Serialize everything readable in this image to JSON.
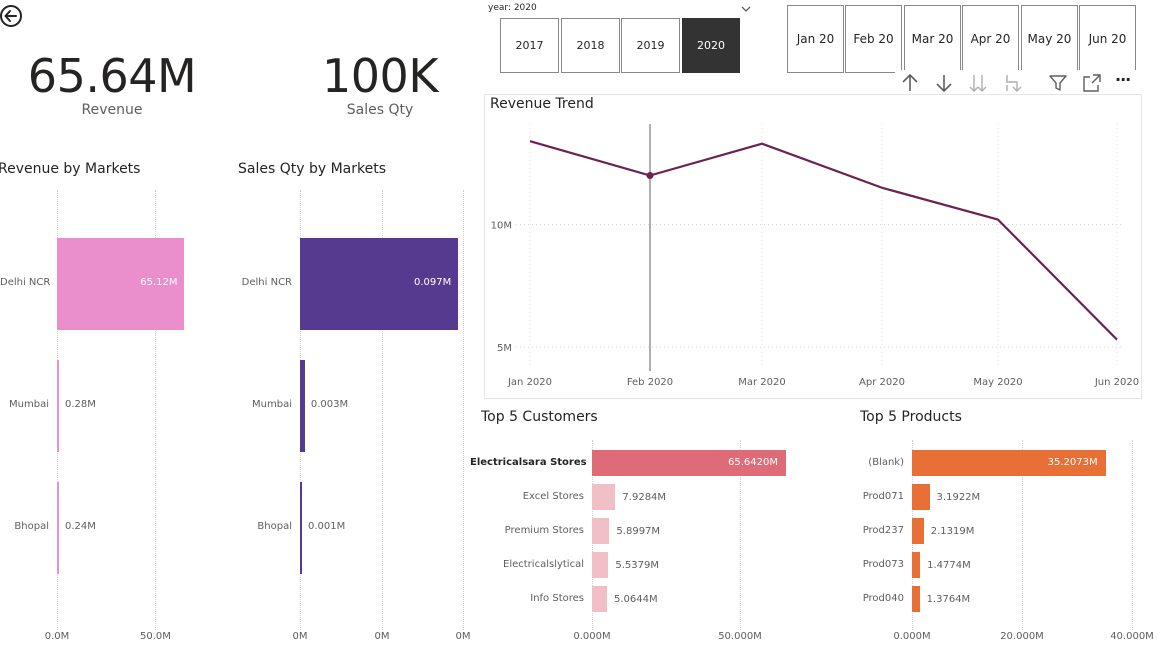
{
  "kpis": {
    "revenue": {
      "value": "65.64M",
      "label": "Revenue"
    },
    "sales_qty": {
      "value": "100K",
      "label": "Sales Qty"
    }
  },
  "year_slicer": {
    "header": "year: 2020",
    "options": [
      "2017",
      "2018",
      "2019",
      "2020"
    ],
    "selected": "2020"
  },
  "month_slicer": {
    "options": [
      "Jan 20",
      "Feb 20",
      "Mar 20",
      "Apr 20",
      "May 20",
      "Jun 20"
    ]
  },
  "toolbar": {
    "icons": [
      "sort-ascending-icon",
      "sort-descending-icon",
      "expand-all-down-icon",
      "expand-down-icon",
      "filter-icon",
      "focus-mode-icon",
      "more-options-icon"
    ],
    "more_label": "···"
  },
  "colors": {
    "revenue_bar": "#ea8fcc",
    "qty_bar": "#563a8f",
    "trend_line": "#6b2152",
    "customers_bar_top": "#e06b78",
    "customers_bar": "#f1c0c6",
    "products_bar": "#e87036"
  },
  "revenue_by_markets": {
    "title": "Revenue by Markets",
    "x_ticks": [
      "0.0M",
      "50.0M"
    ],
    "chart_data": {
      "type": "bar",
      "categories": [
        "Delhi NCR",
        "Mumbai",
        "Bhopal"
      ],
      "values": [
        65.12,
        0.28,
        0.24
      ],
      "value_labels": [
        "65.12M",
        "0.28M",
        "0.24M"
      ],
      "xlim": [
        0,
        65
      ]
    }
  },
  "sales_qty_by_markets": {
    "title": "Sales Qty by Markets",
    "x_ticks": [
      "0M",
      "0M",
      "0M"
    ],
    "chart_data": {
      "type": "bar",
      "categories": [
        "Delhi NCR",
        "Mumbai",
        "Bhopal"
      ],
      "values": [
        0.097,
        0.003,
        0.001
      ],
      "value_labels": [
        "0.097M",
        "0.003M",
        "0.001M"
      ],
      "xlim": [
        0,
        0.097
      ]
    }
  },
  "revenue_trend": {
    "title": "Revenue Trend",
    "y_ticks": [
      "10M",
      "5M"
    ],
    "chart_data": {
      "type": "line",
      "x": [
        "Jan 2020",
        "Feb 2020",
        "Mar 2020",
        "Apr 2020",
        "May 2020",
        "Jun 2020"
      ],
      "y": [
        13.4,
        12.0,
        13.3,
        11.5,
        10.2,
        5.3
      ],
      "ylim": [
        4.5,
        14.5
      ],
      "highlight": "Feb 2020"
    }
  },
  "top_customers": {
    "title": "Top 5 Customers",
    "x_ticks": [
      "0.000M",
      "50.000M"
    ],
    "chart_data": {
      "type": "bar",
      "categories": [
        "Electricalsara Stores",
        "Excel Stores",
        "Premium Stores",
        "Electricalslytical",
        "Info Stores"
      ],
      "values": [
        65.642,
        7.9284,
        5.8997,
        5.5379,
        5.0644
      ],
      "value_labels": [
        "65.6420M",
        "7.9284M",
        "5.8997M",
        "5.5379M",
        "5.0644M"
      ],
      "xlim": [
        0,
        65.642
      ]
    }
  },
  "top_products": {
    "title": "Top 5 Products",
    "x_ticks": [
      "0.000M",
      "20.000M",
      "40.000M"
    ],
    "chart_data": {
      "type": "bar",
      "categories": [
        "(Blank)",
        "Prod071",
        "Prod237",
        "Prod073",
        "Prod040"
      ],
      "values": [
        35.2073,
        3.1922,
        2.1319,
        1.4774,
        1.3764
      ],
      "value_labels": [
        "35.2073M",
        "3.1922M",
        "2.1319M",
        "1.4774M",
        "1.3764M"
      ],
      "xlim": [
        0,
        40
      ]
    }
  }
}
